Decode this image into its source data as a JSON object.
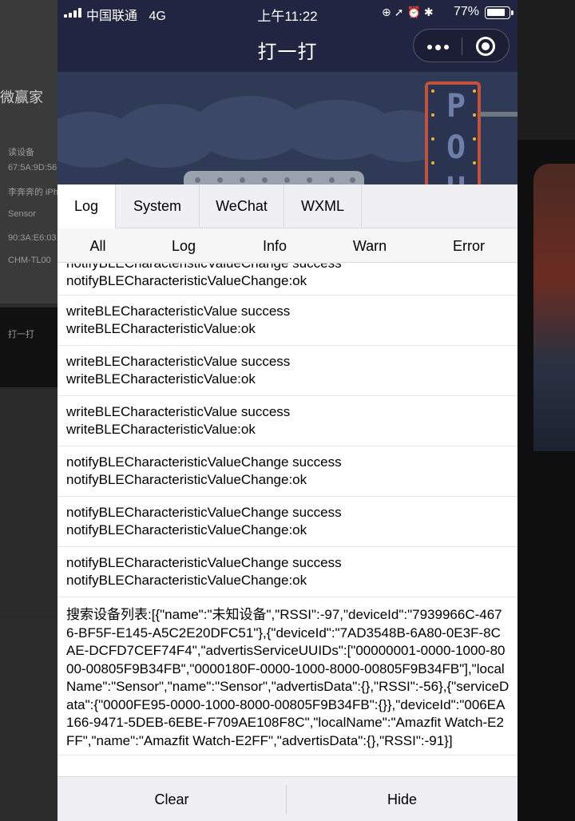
{
  "status_bar": {
    "carrier": "中国联通",
    "network": "4G",
    "time": "上午11:22",
    "battery_percent": "77%",
    "icons": [
      "orientation-lock-icon",
      "location-icon",
      "alarm-icon",
      "bluetooth-icon"
    ]
  },
  "nav": {
    "title": "打一打",
    "more_icon": "more-dots-icon",
    "close_icon": "target-circle-icon"
  },
  "game_sign": [
    "P",
    "O",
    "U"
  ],
  "console": {
    "tabs": [
      {
        "label": "Log",
        "active": true
      },
      {
        "label": "System",
        "active": false
      },
      {
        "label": "WeChat",
        "active": false
      },
      {
        "label": "WXML",
        "active": false
      }
    ],
    "filters": [
      {
        "label": "All",
        "active": true
      },
      {
        "label": "Log",
        "active": false
      },
      {
        "label": "Info",
        "active": false
      },
      {
        "label": "Warn",
        "active": false
      },
      {
        "label": "Error",
        "active": false
      }
    ],
    "logs": [
      {
        "line1": "notifyBLECharacteristicValueChange success",
        "line2": "notifyBLECharacteristicValueChange:ok"
      },
      {
        "line1": "writeBLECharacteristicValue success",
        "line2": "writeBLECharacteristicValue:ok"
      },
      {
        "line1": "writeBLECharacteristicValue success",
        "line2": "writeBLECharacteristicValue:ok"
      },
      {
        "line1": "writeBLECharacteristicValue success",
        "line2": "writeBLECharacteristicValue:ok"
      },
      {
        "line1": "notifyBLECharacteristicValueChange success",
        "line2": "notifyBLECharacteristicValueChange:ok"
      },
      {
        "line1": "notifyBLECharacteristicValueChange success",
        "line2": "notifyBLECharacteristicValueChange:ok"
      },
      {
        "line1": "notifyBLECharacteristicValueChange success",
        "line2": "notifyBLECharacteristicValueChange:ok"
      }
    ],
    "device_list_log": "搜索设备列表:[{\"name\":\"未知设备\",\"RSSI\":-97,\"deviceId\":\"7939966C-4676-BF5F-E145-A5C2E20DFC51\"},{\"deviceId\":\"7AD3548B-6A80-0E3F-8CAE-DCFD7CEF74F4\",\"advertisServiceUUIDs\":[\"00000001-0000-1000-8000-00805F9B34FB\",\"0000180F-0000-1000-8000-00805F9B34FB\"],\"localName\":\"Sensor\",\"name\":\"Sensor\",\"advertisData\":{},\"RSSI\":-56},{\"serviceData\":{\"0000FE95-0000-1000-8000-00805F9B34FB\":{}},\"deviceId\":\"006EA166-9471-5DEB-6EBE-F709AE108F8C\",\"localName\":\"Amazfit Watch-E2FF\",\"name\":\"Amazfit Watch-E2FF\",\"advertisData\":{},\"RSSI\":-91}]",
    "footer": {
      "clear": "Clear",
      "hide": "Hide"
    }
  },
  "background_desktop": {
    "brand": "微赢家",
    "left_texts": [
      "读设备",
      "67:5A:9D:56",
      "李奔奔的 iPh",
      "Sensor",
      "90:3A:E6:03",
      "CHM-TL00",
      "打一打"
    ]
  },
  "colors": {
    "nav_bg": "#222541",
    "console_bar": "#efeff4",
    "divider": "#d9d9d9"
  }
}
